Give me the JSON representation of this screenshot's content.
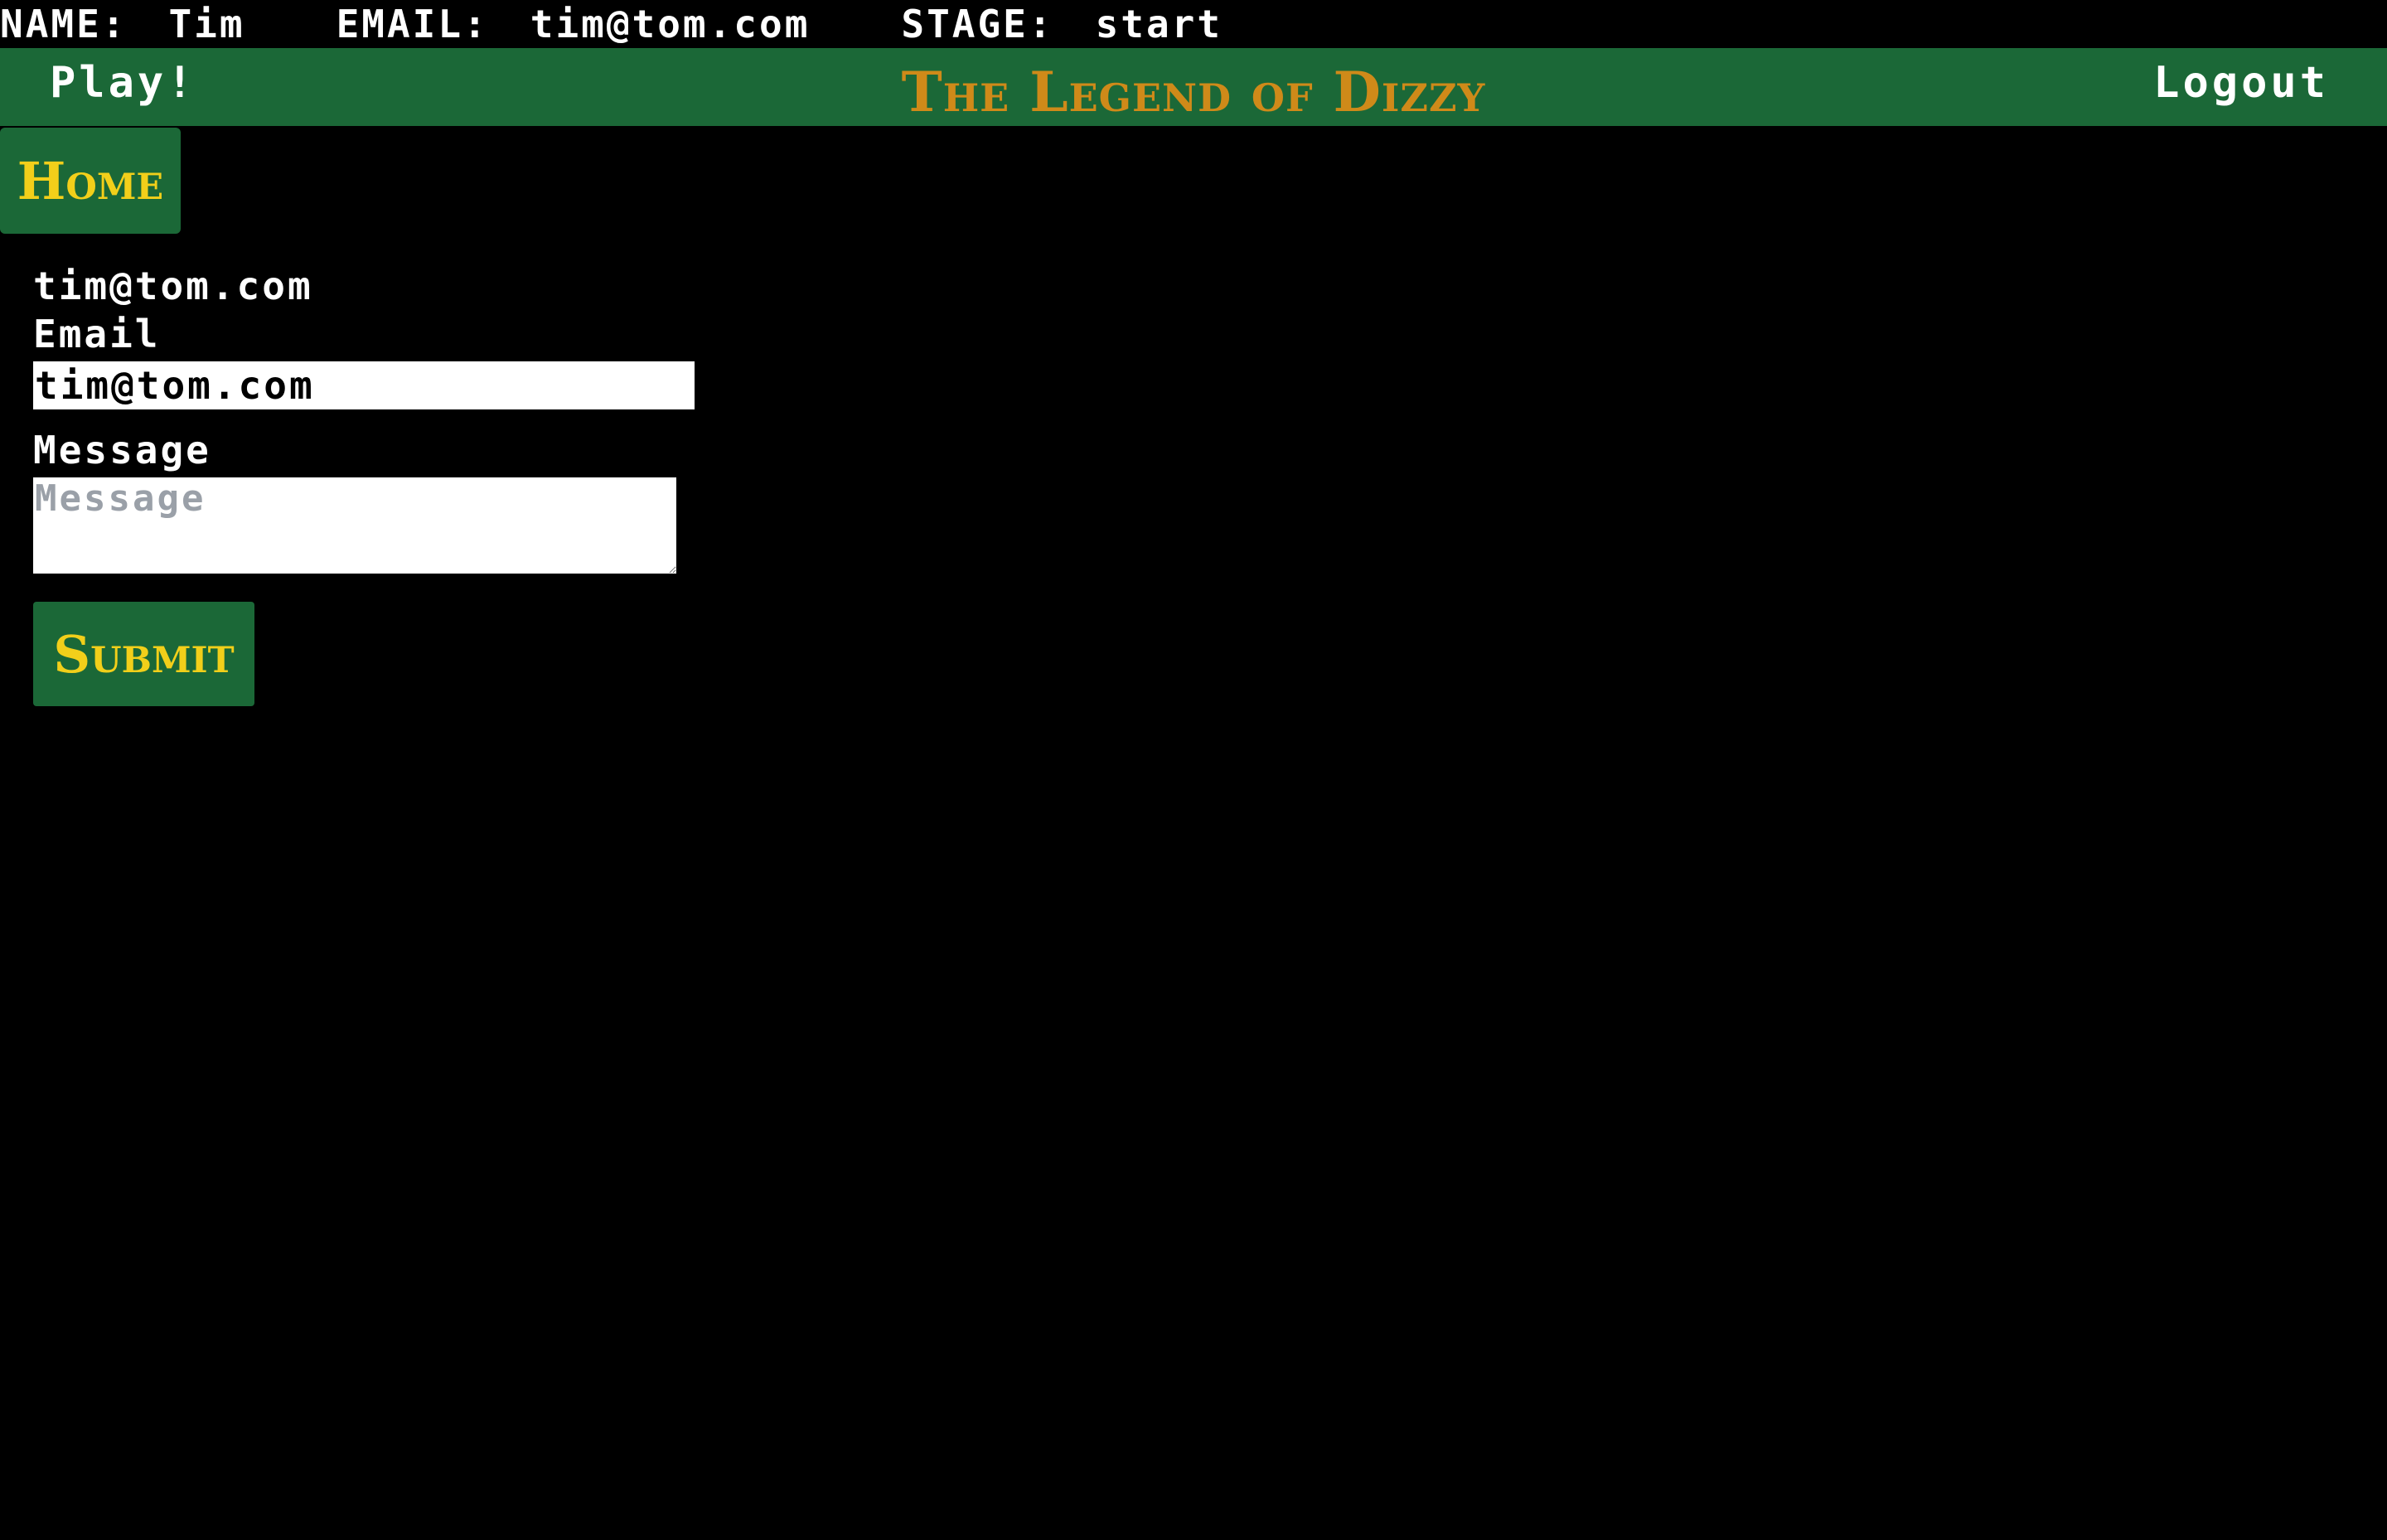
{
  "status": {
    "name_label": "NAME:",
    "name_value": "Tim",
    "email_label": "EMAIL:",
    "email_value": "tim@tom.com",
    "stage_label": "STAGE:",
    "stage_value": "start"
  },
  "nav": {
    "play_label": "Play!",
    "title": "The Legend of Dizzy",
    "logout_label": "Logout"
  },
  "home_button_label": "Home",
  "form": {
    "user_email": "tim@tom.com",
    "email_label": "Email",
    "email_value": "tim@tom.com",
    "message_label": "Message",
    "message_placeholder": "Message",
    "submit_label": "Submit"
  },
  "colors": {
    "nav_green": "#1b6837",
    "title_orange": "#cf8a19",
    "button_text_yellow": "#f2cf1a",
    "background": "#000000"
  }
}
